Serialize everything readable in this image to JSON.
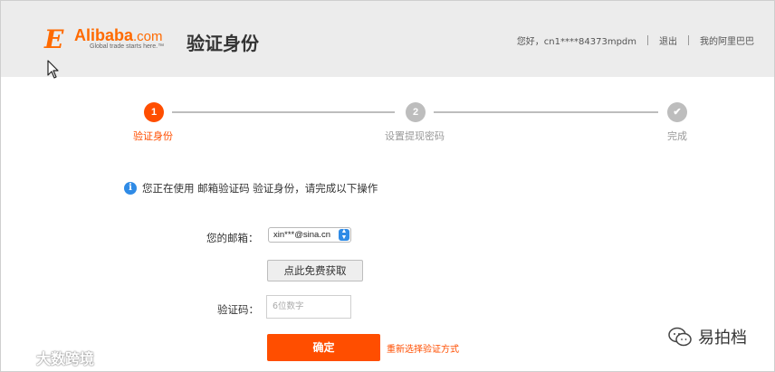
{
  "header": {
    "logo_mark": "E",
    "logo_name": "Alibaba",
    "logo_suffix": ".com",
    "logo_tagline": "Global trade starts here.™",
    "page_title": "验证身份",
    "greeting": "您好，cn1****84373mpdm",
    "logout": "退出",
    "my_alibaba": "我的阿里巴巴"
  },
  "steps": [
    {
      "number": "1",
      "label": "验证身份",
      "state": "active"
    },
    {
      "number": "2",
      "label": "设置提现密码",
      "state": "inactive"
    },
    {
      "number": "✔",
      "label": "完成",
      "state": "inactive"
    }
  ],
  "notice": {
    "icon": "info-icon",
    "text": "您正在使用 邮箱验证码 验证身份，请完成以下操作"
  },
  "form": {
    "email_label": "您的邮箱：",
    "email_value": "xin***@sina.cn",
    "get_code_button": "点此免费获取",
    "code_label": "验证码：",
    "code_placeholder": "6位数字",
    "confirm_button": "确定",
    "reselect_link": "重新选择验证方式"
  },
  "watermarks": {
    "left": "大数跨境",
    "right": "易拍档"
  },
  "colors": {
    "accent": "#ff4e00",
    "brand": "#ff6a00",
    "info": "#2f8be6",
    "inactive": "#bdbdbd",
    "header_bg": "#ececec"
  }
}
